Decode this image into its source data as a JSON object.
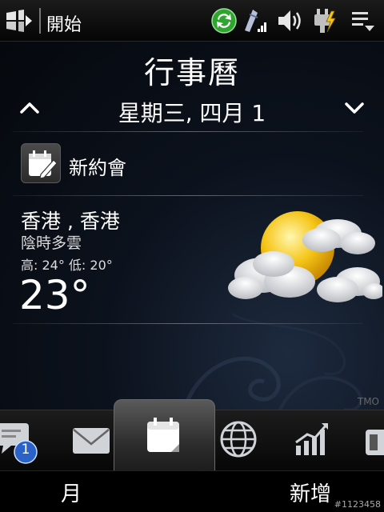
{
  "status_bar": {
    "start_label": "開始",
    "icons": [
      "windows-start-icon",
      "sync-icon",
      "signal-icon",
      "volume-icon",
      "battery-charging-icon",
      "menu-dropdown-icon"
    ]
  },
  "calendar": {
    "title": "行事曆",
    "date": "星期三, 四月 1",
    "new_appointment_label": "新約會"
  },
  "weather": {
    "city": "香港 , 香港",
    "condition": "陰時多雲",
    "high_low": "高: 24° 低: 20°",
    "temperature": "23°",
    "icon": "partly-cloudy-icon"
  },
  "watermark": "TMO",
  "tabs": {
    "items": [
      "messages-tab",
      "mail-tab",
      "calendar-tab",
      "internet-tab",
      "stocks-tab",
      "photos-tab"
    ],
    "active": "calendar-tab",
    "messages_badge": "1"
  },
  "softkeys": {
    "left": "月",
    "right": "新增"
  },
  "image_id": "#1123458",
  "colors": {
    "accent_green": "#3bbf3b",
    "sun_yellow": "#f5c518",
    "badge_blue": "#2a62c9"
  }
}
